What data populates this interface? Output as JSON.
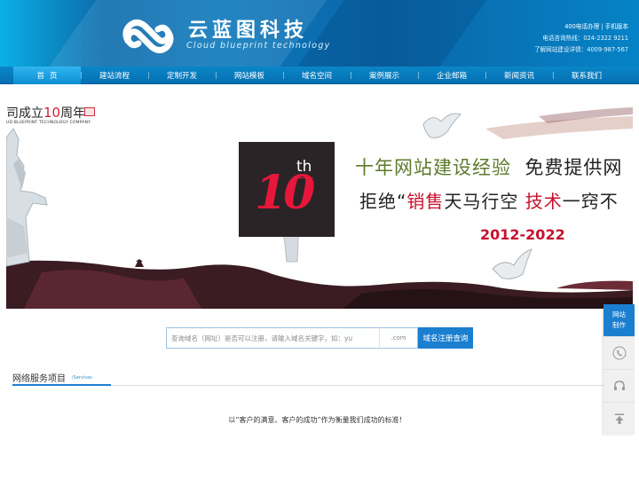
{
  "brand": {
    "name": "云蓝图科技",
    "tagline": "Cloud blueprint technology"
  },
  "header_links": {
    "line1_a": "400电话办理",
    "line1_sep": "|",
    "line1_b": "手机版本",
    "line2": "电话咨询热线：024-2322 9211",
    "line3": "了解网站建设详情：4009-987-567"
  },
  "nav": {
    "items": [
      {
        "label": "首页"
      },
      {
        "label": "建站流程"
      },
      {
        "label": "定制开发"
      },
      {
        "label": "网站模板"
      },
      {
        "label": "域名空间"
      },
      {
        "label": "案例展示"
      },
      {
        "label": "企业邮箱"
      },
      {
        "label": "新闻资讯"
      },
      {
        "label": "联系我们"
      }
    ],
    "active_index": 0
  },
  "banner": {
    "anniversary_prefix": "司成立",
    "anniversary_num": "10",
    "anniversary_suffix": "周年",
    "anniversary_en": "UD BLUEPRINT TECHNOLOGY COMPANY",
    "badge_th": "th",
    "badge_num": "10",
    "slogan1_a": "十年网站建设经验",
    "slogan1_b": "免费提供网",
    "slogan2_a": "拒绝“",
    "slogan2_b": "销售",
    "slogan2_c": "天马行空",
    "slogan2_d": "技术",
    "slogan2_e": "一窍不",
    "years": "2012-2022"
  },
  "search": {
    "placeholder": "查询域名（网址）是否可以注册，请输入域名关键字，如：yu",
    "suffix": ".com",
    "button_label": "域名注册查询"
  },
  "services": {
    "title": "网络服务项目",
    "subtitle": "/Services",
    "motto": "以“客户的满意、客户的成功”作为衡量我们成功的标准！"
  },
  "sidebar": {
    "top_label_1": "网站",
    "top_label_2": "制作",
    "icons": [
      "phone-icon",
      "headset-icon",
      "back-to-top-icon"
    ]
  },
  "colors": {
    "header_blue": "#0c78bb",
    "nav_blue": "#0a86c7",
    "accent_blue": "#1b7fd0",
    "highlight_red": "#c8102e",
    "slogan_green": "#5d7a2b"
  }
}
